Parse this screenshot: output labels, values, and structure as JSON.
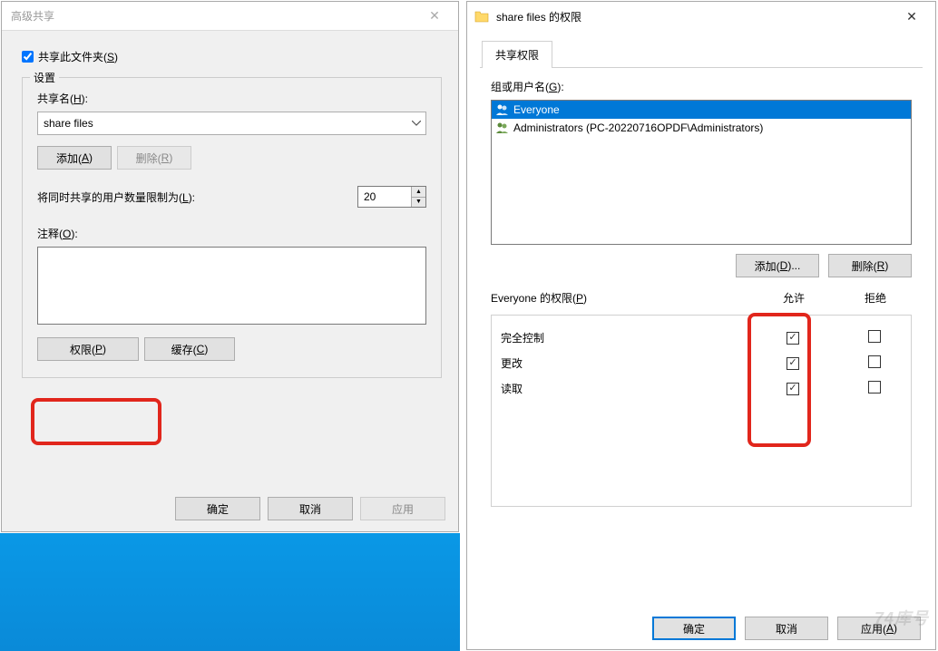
{
  "left": {
    "title": "高级共享",
    "share_checkbox_label": "共享此文件夹(S)",
    "settings_group": "设置",
    "share_name_label": "共享名(H):",
    "share_name_value": "share files",
    "add_btn": "添加(A)",
    "remove_btn": "删除(R)",
    "limit_label": "将同时共享的用户数量限制为(L):",
    "limit_value": "20",
    "comment_label": "注释(O):",
    "comment_value": "",
    "perm_btn": "权限(P)",
    "cache_btn": "缓存(C)",
    "ok_btn": "确定",
    "cancel_btn": "取消",
    "apply_btn": "应用"
  },
  "right": {
    "title": "share files 的权限",
    "tab_label": "共享权限",
    "groups_label": "组或用户名(G):",
    "list": [
      {
        "name": "Everyone",
        "selected": true
      },
      {
        "name": "Administrators (PC-20220716OPDF\\Administrators)",
        "selected": false
      }
    ],
    "add_btn": "添加(D)...",
    "remove_btn": "删除(R)",
    "perm_header_name": "Everyone 的权限(P)",
    "col_allow": "允许",
    "col_deny": "拒绝",
    "rows": [
      {
        "name": "完全控制",
        "allow": true,
        "deny": false
      },
      {
        "name": "更改",
        "allow": true,
        "deny": false
      },
      {
        "name": "读取",
        "allow": true,
        "deny": false
      }
    ],
    "ok_btn": "确定",
    "cancel_btn": "取消",
    "apply_btn": "应用(A)"
  },
  "watermark": "74库号"
}
